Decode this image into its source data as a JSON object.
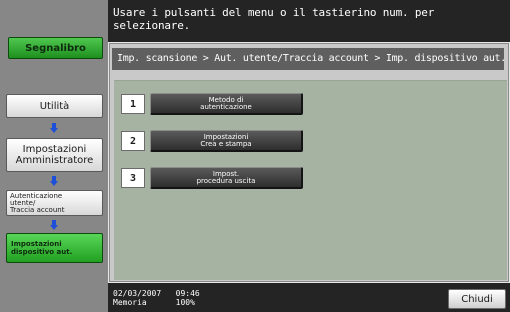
{
  "instruction": "Usare i pulsanti del menu o il tastierino num. per selezionare.",
  "sidebar": {
    "bookmark_label": "Segnalibro",
    "crumbs": {
      "utilita": "Utilità",
      "admin_line1": "Impostazioni",
      "admin_line2": "Amministratore",
      "auth_line1": "Autenticazione",
      "auth_line2": "utente/",
      "auth_line3": "Traccia account",
      "current_line1": "Impostazioni",
      "current_line2": "dispositivo aut."
    }
  },
  "breadcrumb": "Imp. scansione > Aut. utente/Traccia account > Imp. dispositivo aut.",
  "options": [
    {
      "number": "1",
      "line1": "Metodo di",
      "line2": "autenticazione"
    },
    {
      "number": "2",
      "line1": "Impostazioni",
      "line2": "Crea e stampa"
    },
    {
      "number": "3",
      "line1": "Impost.",
      "line2": "procedura uscita"
    }
  ],
  "status": {
    "date": "02/03/2007",
    "time": "09:46",
    "memory_label": "Memoria",
    "memory_value": "100%"
  },
  "close_label": "Chiudi"
}
